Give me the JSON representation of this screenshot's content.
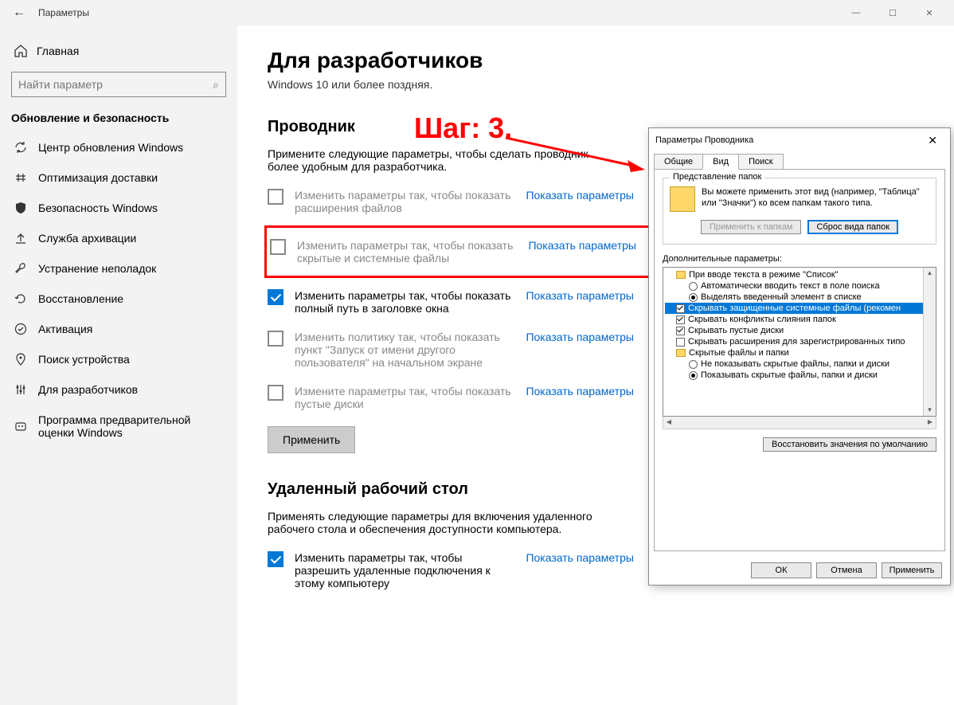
{
  "titlebar": {
    "title": "Параметры"
  },
  "sidebar": {
    "home": "Главная",
    "search_placeholder": "Найти параметр",
    "category": "Обновление и безопасность",
    "items": [
      "Центр обновления Windows",
      "Оптимизация доставки",
      "Безопасность Windows",
      "Служба архивации",
      "Устранение неполадок",
      "Восстановление",
      "Активация",
      "Поиск устройства",
      "Для разработчиков",
      "Программа предварительной оценки Windows"
    ]
  },
  "page": {
    "h1": "Для разработчиков",
    "sub": "Windows 10 или более поздняя.",
    "explorer_h": "Проводник",
    "explorer_desc": "Примените следующие параметры, чтобы сделать проводник более удобным для разработчика.",
    "opts": [
      {
        "label": "Изменить параметры так, чтобы показать расширения файлов",
        "link": "Показать параметры",
        "checked": false
      },
      {
        "label": "Изменить параметры так, чтобы показать скрытые и системные файлы",
        "link": "Показать параметры",
        "checked": false
      },
      {
        "label": "Изменить параметры так, чтобы показать полный путь в заголовке окна",
        "link": "Показать параметры",
        "checked": true
      },
      {
        "label": "Изменить политику так, чтобы показать пункт \"Запуск от имени другого пользователя\" на начальном экране",
        "link": "Показать параметры",
        "checked": false
      },
      {
        "label": "Измените параметры так, чтобы показать пустые диски",
        "link": "Показать параметры",
        "checked": false
      }
    ],
    "apply": "Применить",
    "rdp_h": "Удаленный рабочий стол",
    "rdp_desc": "Применять следующие параметры для включения удаленного рабочего стола и обеспечения доступности компьютера.",
    "rdp_opt": {
      "label": "Изменить параметры так, чтобы разрешить удаленные подключения к этому компьютеру",
      "link": "Показать параметры",
      "checked": true
    }
  },
  "step": "Шаг: 3.",
  "dialog": {
    "title": "Параметры Проводника",
    "tabs": [
      "Общие",
      "Вид",
      "Поиск"
    ],
    "active_tab": 1,
    "fv_legend": "Представление папок",
    "fv_text": "Вы можете применить этот вид (например, \"Таблица\" или \"Значки\") ко всем папкам такого типа.",
    "fv_apply": "Применить к папкам",
    "fv_reset": "Сброс вида папок",
    "adv_label": "Дополнительные параметры:",
    "tree": [
      {
        "type": "folder",
        "ind": 0,
        "text": "При вводе текста в режиме \"Список\""
      },
      {
        "type": "radio",
        "ind": 1,
        "sel": false,
        "text": "Автоматически вводить текст в поле поиска"
      },
      {
        "type": "radio",
        "ind": 1,
        "sel": true,
        "text": "Выделять введенный элемент в списке"
      },
      {
        "type": "check",
        "ind": 0,
        "chk": true,
        "hl": true,
        "text": "Скрывать защищенные системные файлы (рекомен"
      },
      {
        "type": "check",
        "ind": 0,
        "chk": true,
        "text": "Скрывать конфликты слияния папок"
      },
      {
        "type": "check",
        "ind": 0,
        "chk": true,
        "text": "Скрывать пустые диски"
      },
      {
        "type": "check",
        "ind": 0,
        "chk": false,
        "text": "Скрывать расширения для зарегистрированных типо"
      },
      {
        "type": "folder",
        "ind": 0,
        "text": "Скрытые файлы и папки"
      },
      {
        "type": "radio",
        "ind": 1,
        "sel": false,
        "text": "Не показывать скрытые файлы, папки и диски"
      },
      {
        "type": "radio",
        "ind": 1,
        "sel": true,
        "text": "Показывать скрытые файлы, папки и диски"
      }
    ],
    "restore": "Восстановить значения по умолчанию",
    "ok": "ОК",
    "cancel": "Отмена",
    "apply": "Применить"
  }
}
